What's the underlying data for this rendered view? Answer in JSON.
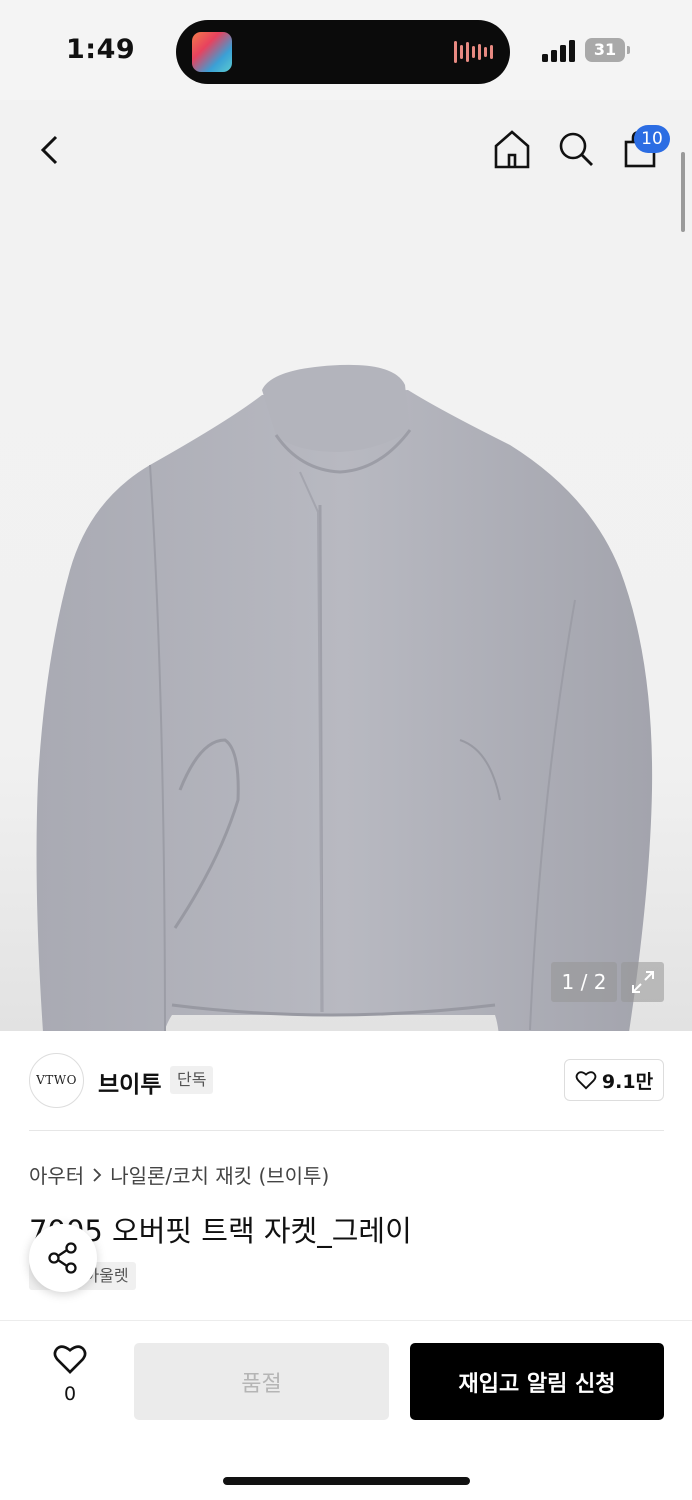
{
  "status_bar": {
    "time": "1:49",
    "battery": "31",
    "now_playing_icon": "music-app-icon"
  },
  "nav": {
    "back_icon": "chevron-left-icon",
    "home_icon": "home-icon",
    "search_icon": "search-icon",
    "cart_icon": "shopping-bag-icon",
    "cart_count": "10"
  },
  "gallery": {
    "image_description": "gray overfit track jacket",
    "counter": "1 / 2",
    "expand_icon": "expand-icon"
  },
  "brand": {
    "logo_text": "VTWO",
    "name": "브이투",
    "tag": "단독",
    "like_count": "9.1만"
  },
  "product": {
    "breadcrumb": [
      "아우터",
      "나일론/코치 재킷 (브이투)"
    ],
    "title": "7005 오버핏 트랙 자켓_그레이",
    "tags": [
      "단독",
      "아울렛"
    ]
  },
  "actions": {
    "wish_count": "0",
    "soldout_label": "품절",
    "restock_label": "재입고 알림 신청"
  },
  "colors": {
    "accent_badge": "#2c6de3",
    "primary_button": "#000000",
    "disabled_button": "#ebebeb"
  }
}
